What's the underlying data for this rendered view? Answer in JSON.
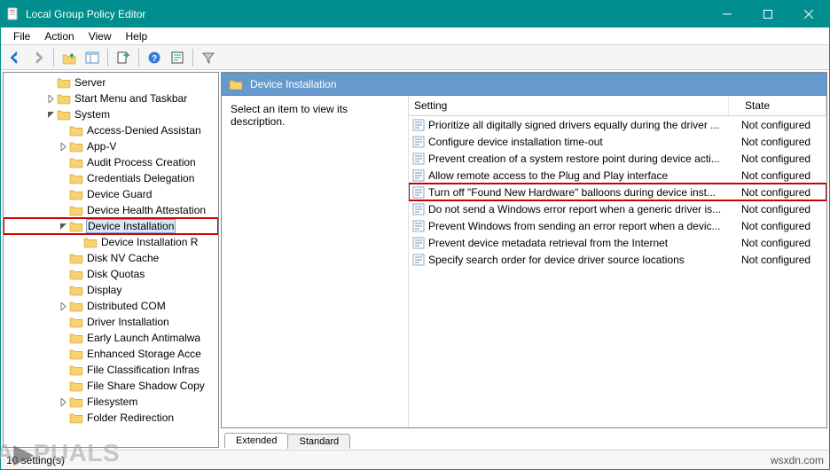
{
  "window": {
    "title": "Local Group Policy Editor"
  },
  "menu": [
    "File",
    "Action",
    "View",
    "Help"
  ],
  "header": {
    "title": "Device Installation"
  },
  "description": {
    "placeholder": "Select an item to view its description."
  },
  "columns": {
    "setting": "Setting",
    "state": "State"
  },
  "tree": [
    {
      "label": "Server",
      "depth": 0,
      "children": false
    },
    {
      "label": "Start Menu and Taskbar",
      "depth": 0,
      "children": true,
      "expanded": false
    },
    {
      "label": "System",
      "depth": 0,
      "children": true,
      "expanded": true
    },
    {
      "label": "Access-Denied Assistan",
      "depth": 1,
      "children": false
    },
    {
      "label": "App-V",
      "depth": 1,
      "children": true,
      "expanded": false
    },
    {
      "label": "Audit Process Creation",
      "depth": 1,
      "children": false
    },
    {
      "label": "Credentials Delegation",
      "depth": 1,
      "children": false
    },
    {
      "label": "Device Guard",
      "depth": 1,
      "children": false
    },
    {
      "label": "Device Health Attestation",
      "depth": 1,
      "children": false
    },
    {
      "label": "Device Installation",
      "depth": 1,
      "children": true,
      "expanded": true,
      "selected": true,
      "highlight": true
    },
    {
      "label": "Device Installation R",
      "depth": 2,
      "children": false
    },
    {
      "label": "Disk NV Cache",
      "depth": 1,
      "children": false
    },
    {
      "label": "Disk Quotas",
      "depth": 1,
      "children": false
    },
    {
      "label": "Display",
      "depth": 1,
      "children": false
    },
    {
      "label": "Distributed COM",
      "depth": 1,
      "children": true,
      "expanded": false
    },
    {
      "label": "Driver Installation",
      "depth": 1,
      "children": false
    },
    {
      "label": "Early Launch Antimalwa",
      "depth": 1,
      "children": false
    },
    {
      "label": "Enhanced Storage Acce",
      "depth": 1,
      "children": false
    },
    {
      "label": "File Classification Infras",
      "depth": 1,
      "children": false
    },
    {
      "label": "File Share Shadow Copy",
      "depth": 1,
      "children": false
    },
    {
      "label": "Filesystem",
      "depth": 1,
      "children": true,
      "expanded": false
    },
    {
      "label": "Folder Redirection",
      "depth": 1,
      "children": false
    }
  ],
  "settings": [
    {
      "label": "Prioritize all digitally signed drivers equally during the driver ...",
      "state": "Not configured"
    },
    {
      "label": "Configure device installation time-out",
      "state": "Not configured"
    },
    {
      "label": "Prevent creation of a system restore point during device acti...",
      "state": "Not configured"
    },
    {
      "label": "Allow remote access to the Plug and Play interface",
      "state": "Not configured"
    },
    {
      "label": "Turn off \"Found New Hardware\" balloons during device inst...",
      "state": "Not configured",
      "highlight": true
    },
    {
      "label": "Do not send a Windows error report when a generic driver is...",
      "state": "Not configured"
    },
    {
      "label": "Prevent Windows from sending an error report when a devic...",
      "state": "Not configured"
    },
    {
      "label": "Prevent device metadata retrieval from the Internet",
      "state": "Not configured"
    },
    {
      "label": "Specify search order for device driver source locations",
      "state": "Not configured"
    }
  ],
  "tabs": {
    "extended": "Extended",
    "standard": "Standard"
  },
  "status": {
    "left": "10 setting(s)",
    "right": "wsxdn.com"
  },
  "watermark": "A▶PUALS"
}
